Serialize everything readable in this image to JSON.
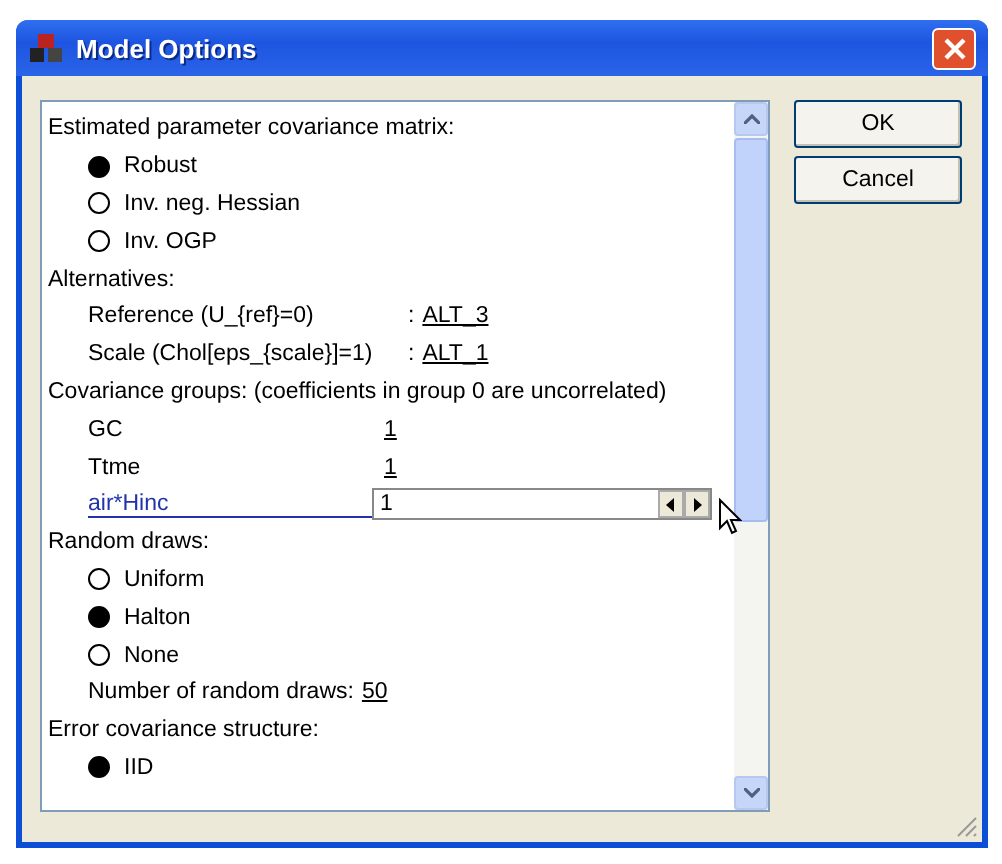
{
  "window": {
    "title": "Model Options"
  },
  "sections": [
    {
      "heading": "Estimated parameter covariance matrix:",
      "items": [
        {
          "kind": "radio",
          "label": "Robust",
          "selected": true
        },
        {
          "kind": "radio",
          "label": "Inv. neg. Hessian",
          "selected": false
        },
        {
          "kind": "radio",
          "label": "Inv. OGP",
          "selected": false
        }
      ]
    },
    {
      "heading": "Alternatives:",
      "items": [
        {
          "kind": "choice",
          "label": "Reference (U_{ref}=0)",
          "separator": ":",
          "value": "ALT_3"
        },
        {
          "kind": "choice",
          "label": "Scale (Chol[eps_{scale}]=1)",
          "separator": ":",
          "value": "ALT_1"
        }
      ]
    },
    {
      "heading": "Covariance groups: (coefficients in group 0 are uncorrelated)",
      "items": [
        {
          "kind": "group",
          "label": "GC",
          "value": "1"
        },
        {
          "kind": "group",
          "label": "Ttme",
          "value": "1"
        },
        {
          "kind": "edit",
          "label": "air*Hinc",
          "value": "1"
        }
      ]
    },
    {
      "heading": "Random draws:",
      "items": [
        {
          "kind": "radio",
          "label": "Uniform",
          "selected": false
        },
        {
          "kind": "radio",
          "label": "Halton",
          "selected": true
        },
        {
          "kind": "radio",
          "label": "None",
          "selected": false
        },
        {
          "kind": "number",
          "label": "Number of random draws:",
          "value": "50"
        }
      ]
    },
    {
      "heading": "Error covariance structure:",
      "items": [
        {
          "kind": "radio",
          "label": "IID",
          "selected": true
        }
      ]
    }
  ],
  "buttons": [
    "OK",
    "Cancel"
  ]
}
